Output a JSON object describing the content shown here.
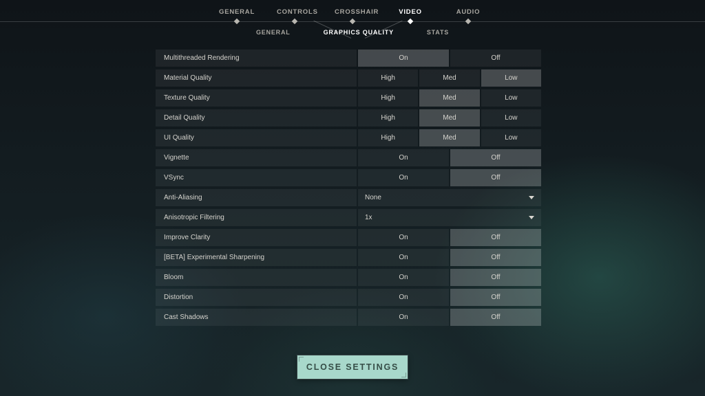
{
  "primaryTabs": {
    "items": [
      "GENERAL",
      "CONTROLS",
      "CROSSHAIR",
      "VIDEO",
      "AUDIO"
    ],
    "activeIndex": 3
  },
  "secondaryTabs": {
    "items": [
      "GENERAL",
      "GRAPHICS QUALITY",
      "STATS"
    ],
    "activeIndex": 1
  },
  "settings": [
    {
      "label": "Multithreaded Rendering",
      "type": "toggle2",
      "options": [
        "On",
        "Off"
      ],
      "selected": 0
    },
    {
      "label": "Material Quality",
      "type": "toggle3",
      "options": [
        "High",
        "Med",
        "Low"
      ],
      "selected": 2
    },
    {
      "label": "Texture Quality",
      "type": "toggle3",
      "options": [
        "High",
        "Med",
        "Low"
      ],
      "selected": 1
    },
    {
      "label": "Detail Quality",
      "type": "toggle3",
      "options": [
        "High",
        "Med",
        "Low"
      ],
      "selected": 1
    },
    {
      "label": "UI Quality",
      "type": "toggle3",
      "options": [
        "High",
        "Med",
        "Low"
      ],
      "selected": 1
    },
    {
      "label": "Vignette",
      "type": "toggle2",
      "options": [
        "On",
        "Off"
      ],
      "selected": 1
    },
    {
      "label": "VSync",
      "type": "toggle2",
      "options": [
        "On",
        "Off"
      ],
      "selected": 1
    },
    {
      "label": "Anti-Aliasing",
      "type": "dropdown",
      "value": "None"
    },
    {
      "label": "Anisotropic Filtering",
      "type": "dropdown",
      "value": "1x"
    },
    {
      "label": "Improve Clarity",
      "type": "toggle2",
      "options": [
        "On",
        "Off"
      ],
      "selected": 1
    },
    {
      "label": "[BETA] Experimental Sharpening",
      "type": "toggle2",
      "options": [
        "On",
        "Off"
      ],
      "selected": 1
    },
    {
      "label": "Bloom",
      "type": "toggle2",
      "options": [
        "On",
        "Off"
      ],
      "selected": 1
    },
    {
      "label": "Distortion",
      "type": "toggle2",
      "options": [
        "On",
        "Off"
      ],
      "selected": 1
    },
    {
      "label": "Cast Shadows",
      "type": "toggle2",
      "options": [
        "On",
        "Off"
      ],
      "selected": 1
    }
  ],
  "closeButton": {
    "label": "CLOSE SETTINGS"
  }
}
